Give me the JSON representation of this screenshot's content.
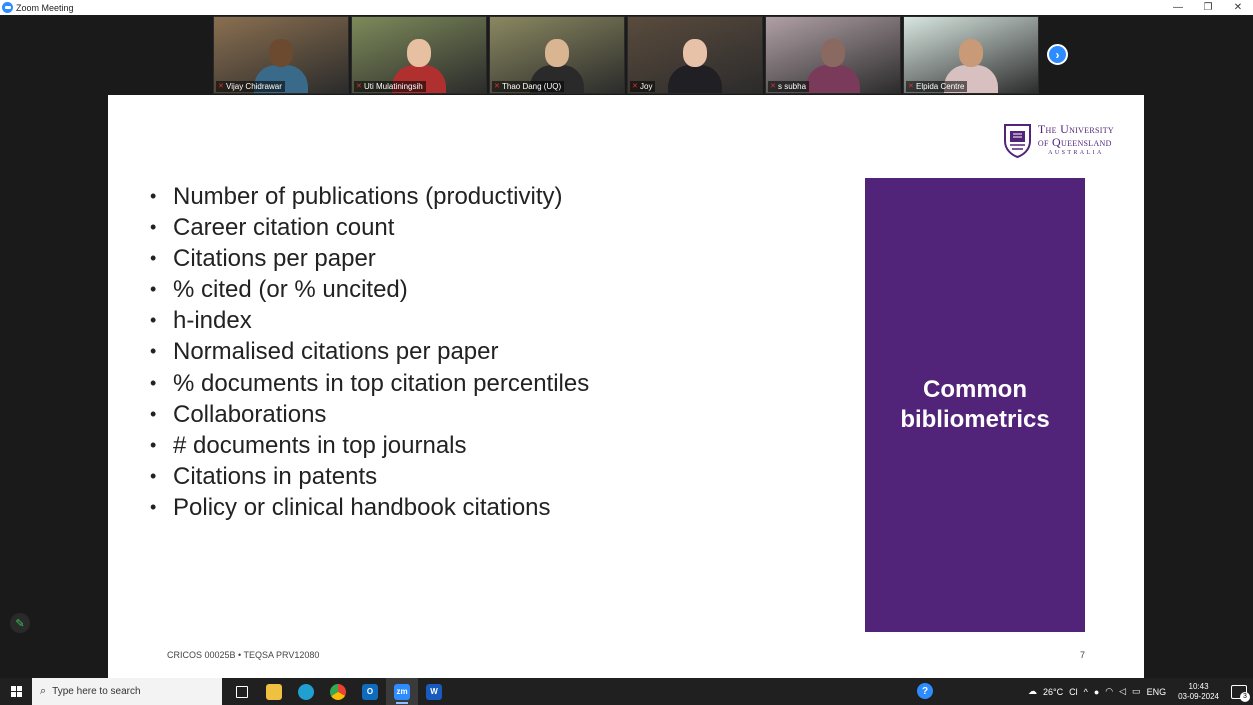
{
  "window": {
    "title": "Zoom Meeting",
    "controls": {
      "minimize": "—",
      "restore": "❐",
      "close": "✕"
    }
  },
  "participants": [
    {
      "name": "Vijay Chidrawar",
      "bg": "#8a6f50",
      "skin": "#6b4a30",
      "shirt": "#3a6a8a"
    },
    {
      "name": "Uti Mulatiningsih",
      "bg": "#7d8a5a",
      "skin": "#e6c0a0",
      "shirt": "#b03030"
    },
    {
      "name": "Thao Dang (UQ)",
      "bg": "#8a8860",
      "skin": "#d9b592",
      "shirt": "#2a2a2a"
    },
    {
      "name": "Joy",
      "bg": "#5a4b3d",
      "skin": "#e8c2a8",
      "shirt": "#1f1f24"
    },
    {
      "name": "s subha",
      "bg": "#b0a0a6",
      "skin": "#8a6a60",
      "shirt": "#7a3a5a"
    },
    {
      "name": "Elpida Centre",
      "bg": "#d8e6e0",
      "skin": "#c89a78",
      "shirt": "#d8c0c0"
    }
  ],
  "slide": {
    "logo": {
      "line1": "The University",
      "line2": "of Queensland",
      "line3": "AUSTRALIA"
    },
    "bullets": [
      "Number of publications (productivity)",
      "Career citation count",
      "Citations per paper",
      "% cited (or % uncited)",
      "h-index",
      "Normalised citations per paper",
      "% documents in top citation percentiles",
      "Collaborations",
      "# documents in top journals",
      "Citations in patents",
      "Policy or clinical handbook citations"
    ],
    "box_caption_line1": "Common",
    "box_caption_line2": "bibliometrics",
    "footer_left": "CRICOS 00025B • TEQSA PRV12080",
    "page_number": "7"
  },
  "taskbar": {
    "search_placeholder": "Type here to search",
    "weather": "26°C",
    "weather_short": "Cl",
    "language": "ENG",
    "time": "10:43",
    "date": "03-09-2024",
    "notifications": "3"
  },
  "colors": {
    "uq_purple": "#51247a",
    "zoom_blue": "#2d8cff"
  }
}
